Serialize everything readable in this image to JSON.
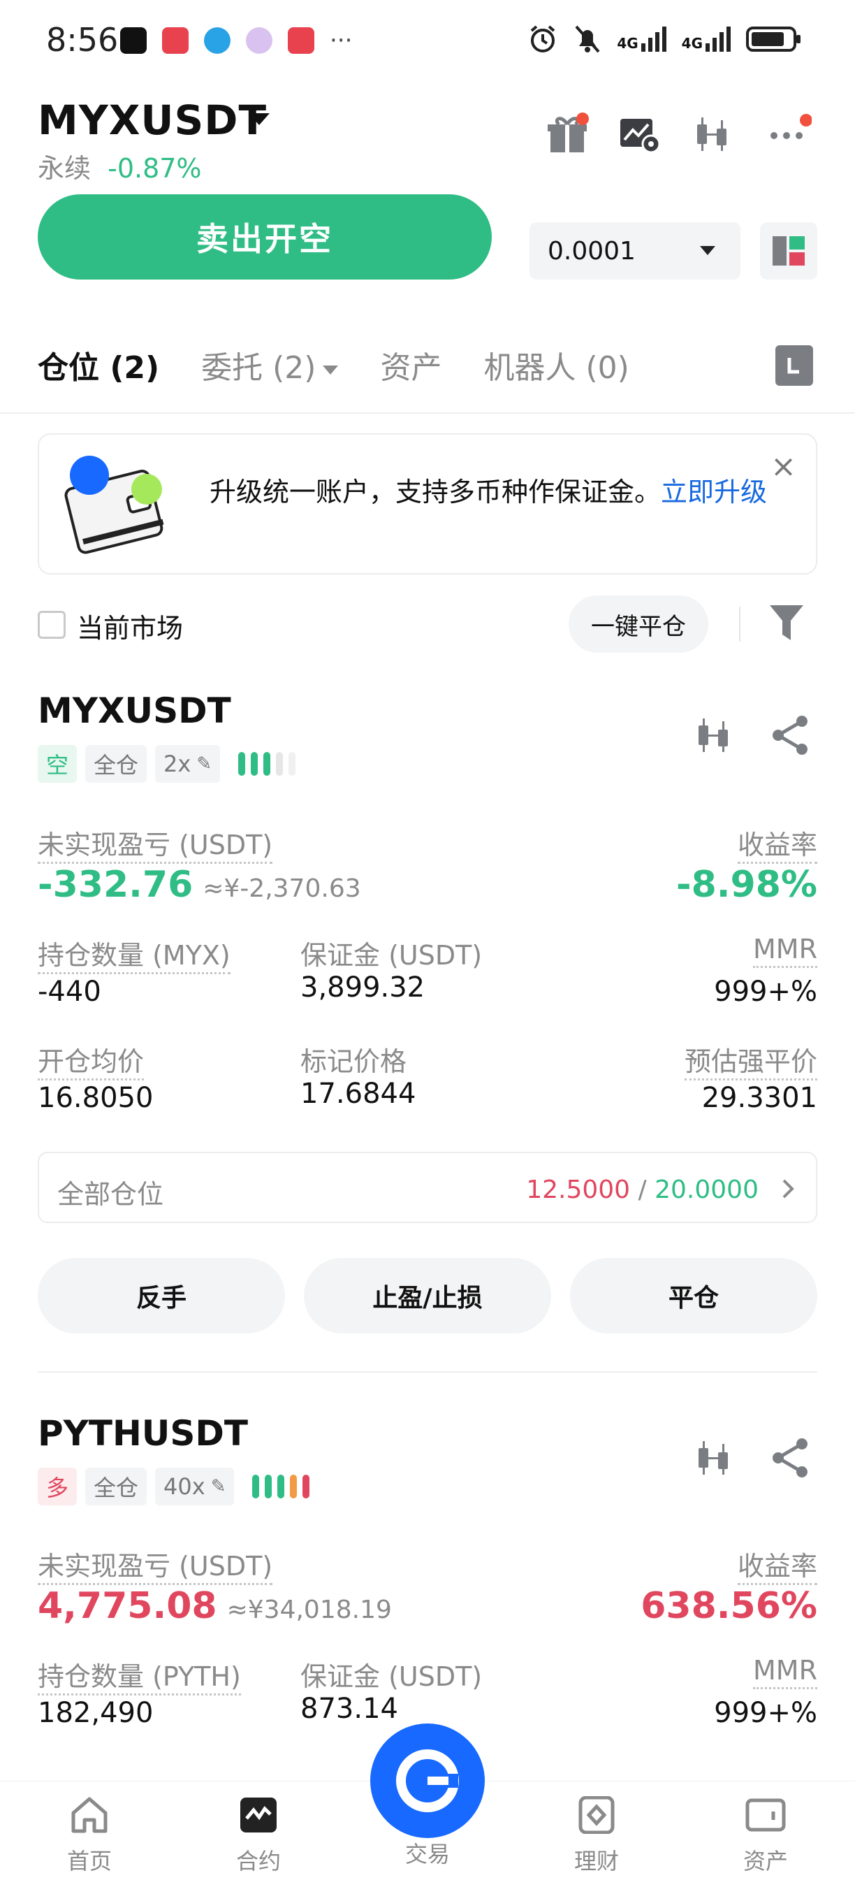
{
  "status_bar": {
    "time": "8:56",
    "more": "···",
    "net1": "4G",
    "net2": "4G"
  },
  "header": {
    "pair": "MYXUSDT",
    "type": "永续",
    "change": "-0.87%",
    "sell_button": "卖出开空",
    "quantity": "0.0001"
  },
  "tabs": [
    {
      "label": "仓位 (2)"
    },
    {
      "label": "委托 (2)"
    },
    {
      "label": "资产"
    },
    {
      "label": "机器人 (0)"
    }
  ],
  "banner": {
    "text": "升级统一账户，支持多币种作保证金。",
    "link": "立即升级",
    "close": "×"
  },
  "filter": {
    "current_market": "当前市场",
    "close_all": "一键平仓"
  },
  "positions": [
    {
      "symbol": "MYXUSDT",
      "side": "空",
      "margin_mode": "全仓",
      "leverage": "2x",
      "risk_level": 3,
      "unrealized_label": "未实现盈亏 (USDT)",
      "unrealized": "-332.76",
      "unrealized_cny": "≈¥-2,370.63",
      "roe_label": "收益率",
      "roe": "-8.98%",
      "size_label": "持仓数量 (MYX)",
      "size": "-440",
      "margin_label": "保证金 (USDT)",
      "margin": "3,899.32",
      "mmr_label": "MMR",
      "mmr": "999+%",
      "entry_label": "开仓均价",
      "entry": "16.8050",
      "mark_label": "标记价格",
      "mark": "17.6844",
      "liq_label": "预估强平价",
      "liq": "29.3301",
      "all_positions_label": "全部仓位",
      "all_positions_a": "12.5000",
      "all_positions_sep": "/",
      "all_positions_b": "20.0000",
      "buttons": [
        "反手",
        "止盈/止损",
        "平仓"
      ]
    },
    {
      "symbol": "PYTHUSDT",
      "side": "多",
      "margin_mode": "全仓",
      "leverage": "40x",
      "risk_level": 5,
      "unrealized_label": "未实现盈亏 (USDT)",
      "unrealized": "4,775.08",
      "unrealized_cny": "≈¥34,018.19",
      "roe_label": "收益率",
      "roe": "638.56%",
      "size_label": "持仓数量 (PYTH)",
      "size": "182,490",
      "margin_label": "保证金 (USDT)",
      "margin": "873.14",
      "mmr_label": "MMR",
      "mmr": "999+%"
    }
  ],
  "bottom_nav": [
    {
      "label": "首页",
      "icon": "home-icon"
    },
    {
      "label": "合约",
      "icon": "futures-icon"
    },
    {
      "label": "交易",
      "icon": "trade-icon"
    },
    {
      "label": "理财",
      "icon": "finance-icon"
    },
    {
      "label": "资产",
      "icon": "wallet-icon"
    }
  ],
  "colors": {
    "green": "#2fbd85",
    "red": "#e0475f",
    "orange": "#f29a45",
    "blue": "#1769ff"
  }
}
